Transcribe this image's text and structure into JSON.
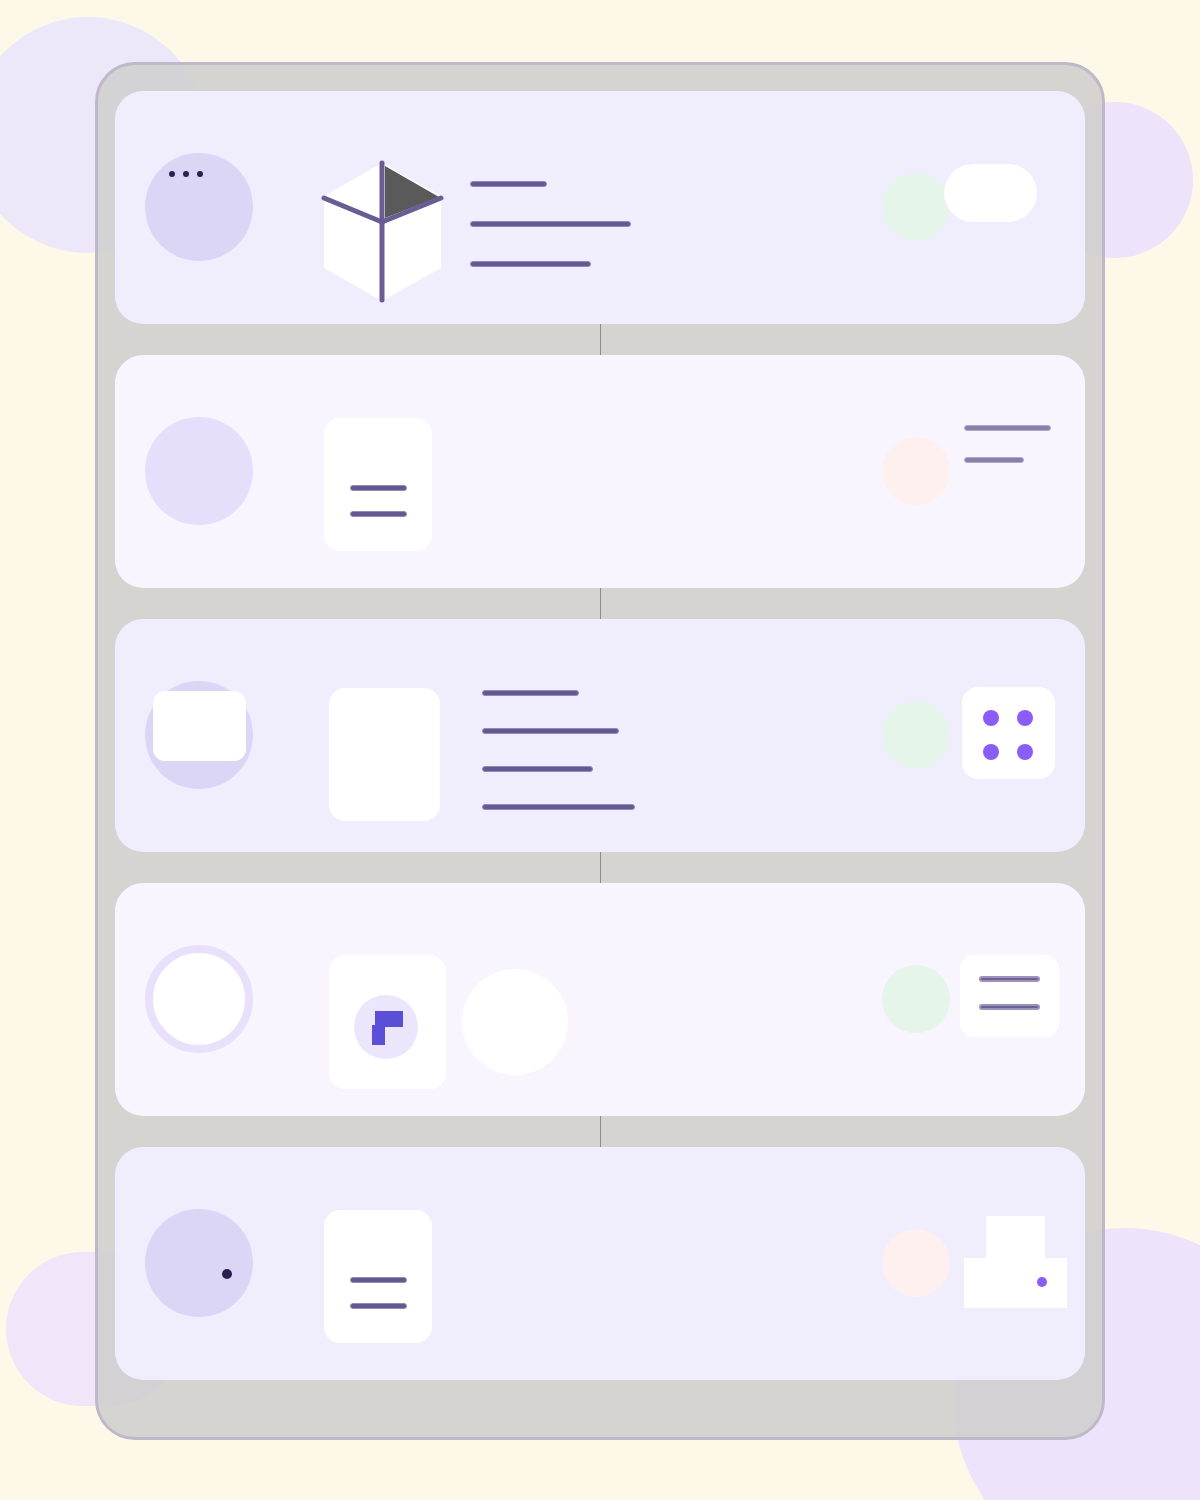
{
  "cards": [
    {
      "avatar": {
        "kind": "dots"
      },
      "media": {
        "kind": "cube"
      },
      "detail": {
        "kind": "three-lines"
      },
      "status": {
        "color": "#e5f5ea"
      },
      "action": {
        "kind": "pill"
      }
    },
    {
      "avatar": {
        "kind": "plain"
      },
      "media": {
        "kind": "note"
      },
      "status": {
        "color": "#fdf0ef"
      },
      "action": {
        "kind": "two-lines"
      }
    },
    {
      "avatar": {
        "kind": "card"
      },
      "media": {
        "kind": "blank"
      },
      "detail": {
        "kind": "four-lines"
      },
      "status": {
        "color": "#e5f5ea"
      },
      "action": {
        "kind": "dots-grid"
      }
    },
    {
      "avatar": {
        "kind": "ring"
      },
      "media": {
        "kind": "corner"
      },
      "detail": {
        "kind": "circle"
      },
      "status": {
        "color": "#e5f5ea"
      },
      "action": {
        "kind": "list"
      }
    },
    {
      "avatar": {
        "kind": "dot"
      },
      "media": {
        "kind": "note"
      },
      "status": {
        "color": "#fdf0ef"
      },
      "action": {
        "kind": "printer"
      }
    }
  ]
}
